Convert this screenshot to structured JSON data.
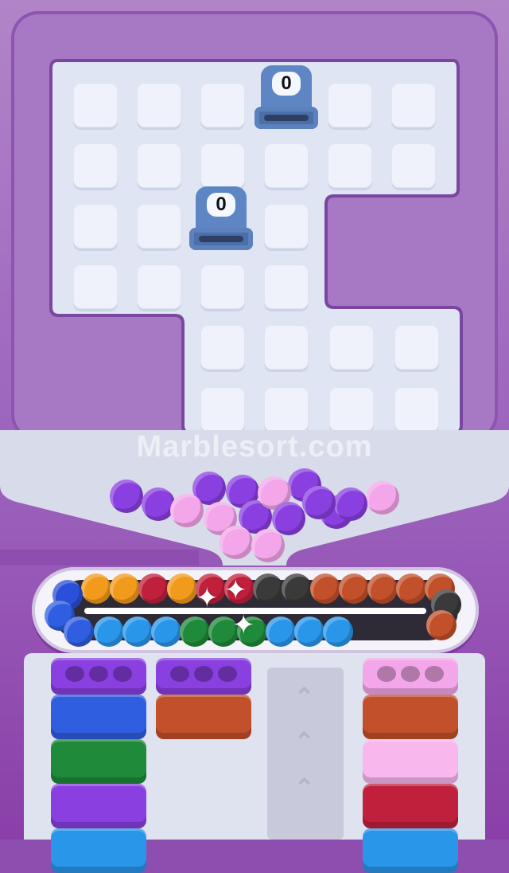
{
  "watermark": {
    "main": "Marblesort.com"
  },
  "dispensers": [
    {
      "count": "0"
    },
    {
      "count": "0"
    }
  ],
  "colors": {
    "purple": "#8a3fe0",
    "pink": "#f4a6ea",
    "orange": "#f29a1c",
    "crimson": "#c0203c",
    "black": "#3a3a3a",
    "brown": "#c2502a",
    "blue": "#2f5ee0",
    "sky": "#2a96ea",
    "green": "#1f8a3a",
    "dark_blue": "#2a4fd8",
    "light_pink": "#f8b8ee"
  },
  "hopper_marbles": [
    "purple",
    "purple",
    "purple",
    "purple",
    "pink",
    "purple",
    "purple",
    "purple",
    "pink",
    "pink",
    "pink",
    "purple",
    "purple",
    "pink",
    "pink",
    "purple",
    "pink",
    "pink"
  ],
  "conveyor_top": [
    "orange",
    "orange",
    "crimson",
    "orange",
    "crimson",
    "crimson",
    "black",
    "black",
    "brown",
    "brown",
    "brown",
    "brown",
    "brown"
  ],
  "conveyor_bottom": [
    "sky",
    "sky",
    "sky",
    "green",
    "green",
    "green",
    "sky",
    "sky",
    "sky"
  ],
  "columns": [
    {
      "top": "purple",
      "blocks": [
        "blue",
        "green",
        "purple",
        "sky"
      ]
    },
    {
      "top": "purple",
      "blocks": [
        "brown"
      ]
    },
    {
      "top": "pink",
      "blocks": [
        "brown",
        "light_pink",
        "crimson",
        "sky"
      ]
    }
  ]
}
